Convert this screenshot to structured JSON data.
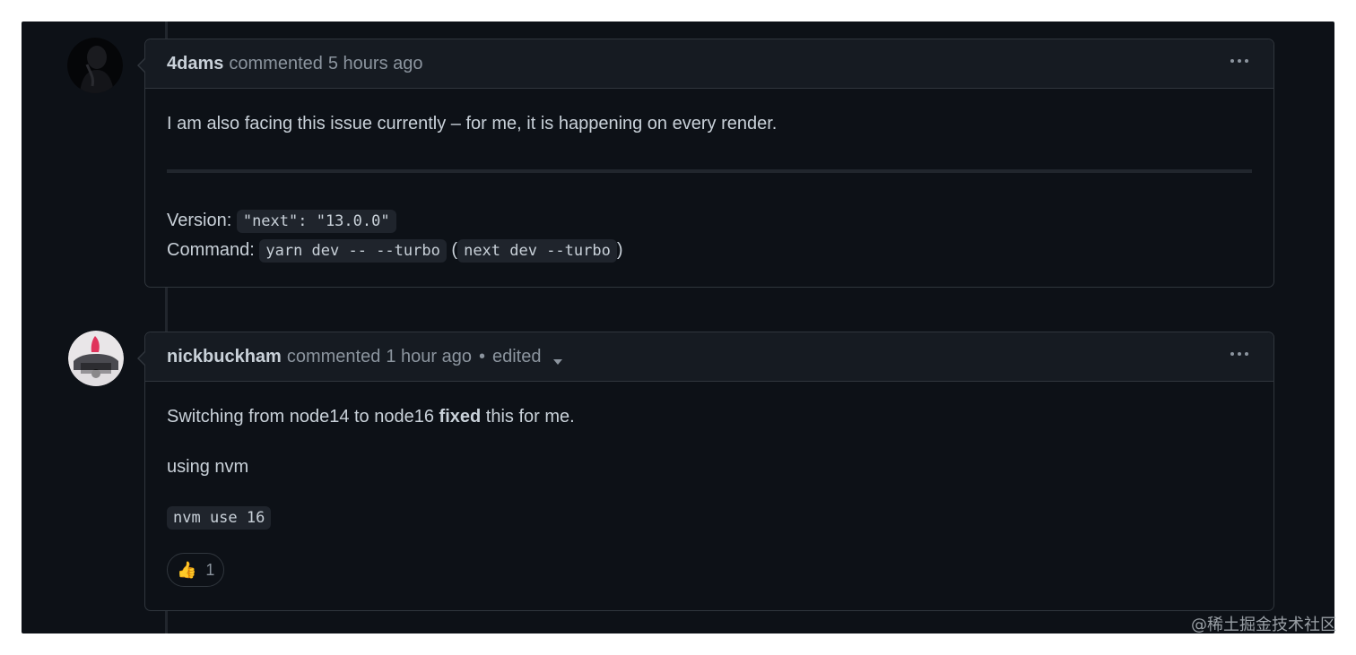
{
  "comments": [
    {
      "author": "4dams",
      "action": "commented",
      "time": "5 hours ago",
      "body": {
        "text": "I am also facing this issue currently – for me, it is happening on every render.",
        "version_label": "Version:",
        "version_code": "\"next\": \"13.0.0\"",
        "command_label": "Command:",
        "command_code": "yarn dev -- --turbo",
        "paren_open": "(",
        "command_alt_code": "next dev --turbo",
        "paren_close": ")"
      }
    },
    {
      "author": "nickbuckham",
      "action": "commented",
      "time": "1 hour ago",
      "edited_separator": "•",
      "edited_label": "edited",
      "body": {
        "line1_before": "Switching from node14 to node16 ",
        "line1_bold": "fixed",
        "line1_after": " this for me.",
        "line2": "using nvm",
        "code": "nvm use 16"
      },
      "reaction": {
        "icon": "thumbs-up-icon",
        "count": "1"
      }
    }
  ],
  "watermark": "@稀土掘金技术社区",
  "colors": {
    "background": "#0d1117",
    "header": "#161b22",
    "border": "#30363d",
    "text": "#c9d1d9",
    "muted": "#8b949e"
  }
}
